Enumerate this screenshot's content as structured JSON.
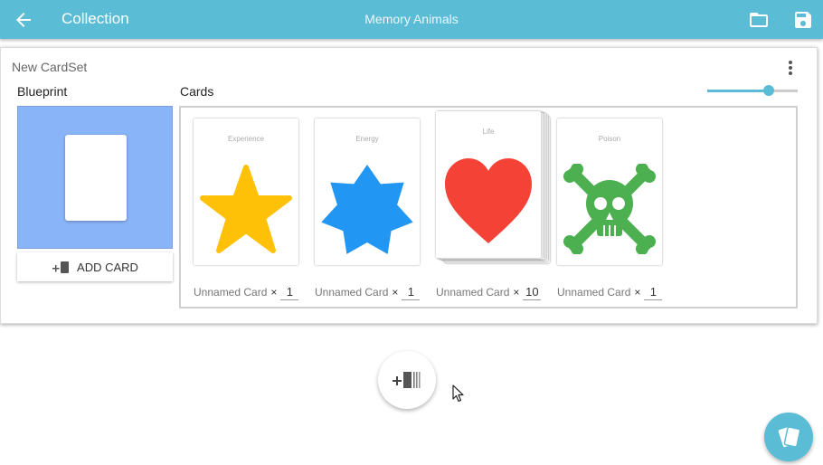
{
  "appbar": {
    "back_icon": "arrow-back-icon",
    "title": "Collection",
    "center_title": "Memory Animals",
    "open_icon": "folder-icon",
    "save_icon": "save-icon",
    "color": "#5bbcd6"
  },
  "cardset": {
    "name": "New CardSet",
    "menu_icon": "more-vert-icon",
    "blueprint_label": "Blueprint",
    "cards_label": "Cards",
    "add_card_label": "ADD CARD",
    "zoom_slider_value": 0.68,
    "cards": [
      {
        "caption": "Experience",
        "name": "Unnamed Card",
        "times": "×",
        "quantity": "1",
        "shape": "star-5",
        "color": "#ffc107"
      },
      {
        "caption": "Energy",
        "name": "Unnamed Card",
        "times": "×",
        "quantity": "1",
        "shape": "star-7",
        "color": "#2196f3"
      },
      {
        "caption": "Life",
        "name": "Unnamed Card",
        "times": "×",
        "quantity": "10",
        "shape": "heart",
        "color": "#f44336"
      },
      {
        "caption": "Poison",
        "name": "Unnamed Card",
        "times": "×",
        "quantity": "1",
        "shape": "skull-crossbones",
        "color": "#4caf50"
      }
    ]
  },
  "fab": {
    "add_cardset_icon": "add-cardset-icon",
    "cards_icon": "cards-icon"
  }
}
